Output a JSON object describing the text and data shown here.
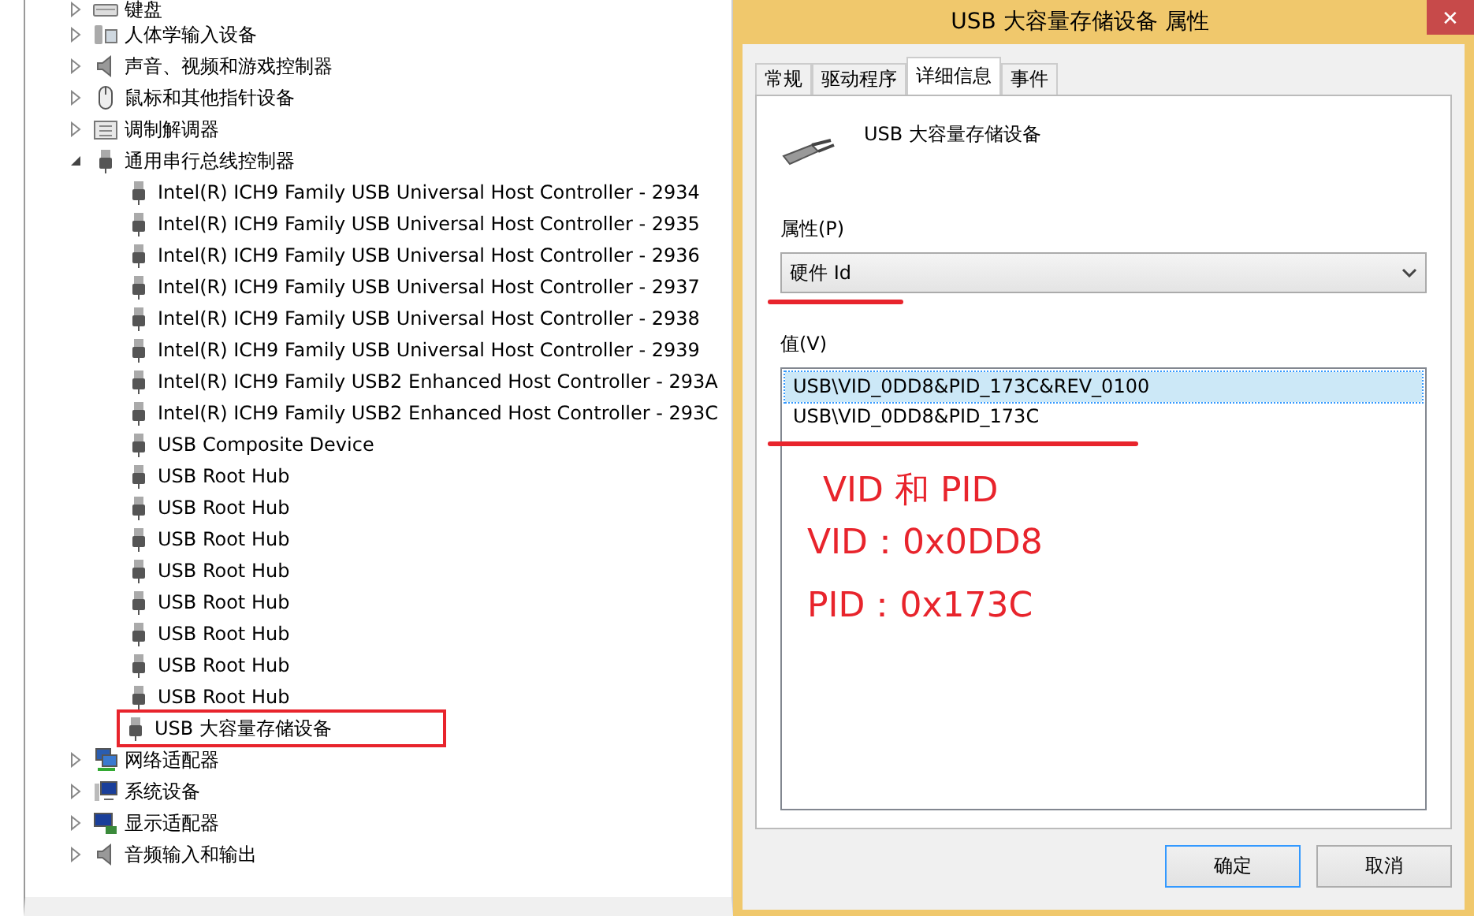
{
  "device_tree": [
    {
      "label": "键盘",
      "kind": "keyboard",
      "expanded": false
    },
    {
      "label": "人体学输入设备",
      "kind": "hid",
      "expanded": false
    },
    {
      "label": "声音、视频和游戏控制器",
      "kind": "speaker",
      "expanded": false
    },
    {
      "label": "鼠标和其他指针设备",
      "kind": "mouse",
      "expanded": false
    },
    {
      "label": "调制解调器",
      "kind": "modem",
      "expanded": false
    },
    {
      "label": "通用串行总线控制器",
      "kind": "usb",
      "expanded": true,
      "children": [
        {
          "label": "Intel(R) ICH9 Family USB Universal Host Controller - 2934",
          "marked": false
        },
        {
          "label": "Intel(R) ICH9 Family USB Universal Host Controller - 2935",
          "marked": false
        },
        {
          "label": "Intel(R) ICH9 Family USB Universal Host Controller - 2936",
          "marked": false
        },
        {
          "label": "Intel(R) ICH9 Family USB Universal Host Controller - 2937",
          "marked": false
        },
        {
          "label": "Intel(R) ICH9 Family USB Universal Host Controller - 2938",
          "marked": false
        },
        {
          "label": "Intel(R) ICH9 Family USB Universal Host Controller - 2939",
          "marked": false
        },
        {
          "label": "Intel(R) ICH9 Family USB2 Enhanced Host Controller - 293A",
          "marked": false
        },
        {
          "label": "Intel(R) ICH9 Family USB2 Enhanced Host Controller - 293C",
          "marked": false
        },
        {
          "label": "USB Composite Device",
          "marked": false
        },
        {
          "label": "USB Root Hub",
          "marked": false
        },
        {
          "label": "USB Root Hub",
          "marked": false
        },
        {
          "label": "USB Root Hub",
          "marked": false
        },
        {
          "label": "USB Root Hub",
          "marked": false
        },
        {
          "label": "USB Root Hub",
          "marked": false
        },
        {
          "label": "USB Root Hub",
          "marked": false
        },
        {
          "label": "USB Root Hub",
          "marked": false
        },
        {
          "label": "USB Root Hub",
          "marked": false
        },
        {
          "label": "USB 大容量存储设备",
          "marked": true
        }
      ]
    },
    {
      "label": "网络适配器",
      "kind": "network",
      "expanded": false
    },
    {
      "label": "系统设备",
      "kind": "system",
      "expanded": false
    },
    {
      "label": "显示适配器",
      "kind": "display",
      "expanded": false
    },
    {
      "label": "音频输入和输出",
      "kind": "speaker",
      "expanded": false
    }
  ],
  "dialog": {
    "title": "USB 大容量存储设备 属性",
    "close": "✕",
    "tabs": [
      {
        "label": "常规",
        "selected": false
      },
      {
        "label": "驱动程序",
        "selected": false
      },
      {
        "label": "详细信息",
        "selected": true
      },
      {
        "label": "事件",
        "selected": false
      }
    ],
    "device_name": "USB 大容量存储设备",
    "property_label": "属性(P)",
    "property_value": "硬件 Id",
    "property_underlined": true,
    "value_label": "值(V)",
    "values": [
      {
        "text": "USB\\VID_0DD8&PID_173C&REV_0100",
        "selected": true
      },
      {
        "text": "USB\\VID_0DD8&PID_173C",
        "selected": false
      }
    ],
    "values_underlined": true,
    "annotation_lines": [
      "VID  和 PID",
      "VID：0x0DD8",
      "PID：0x173C"
    ],
    "buttons": [
      "确定",
      "取消"
    ]
  }
}
